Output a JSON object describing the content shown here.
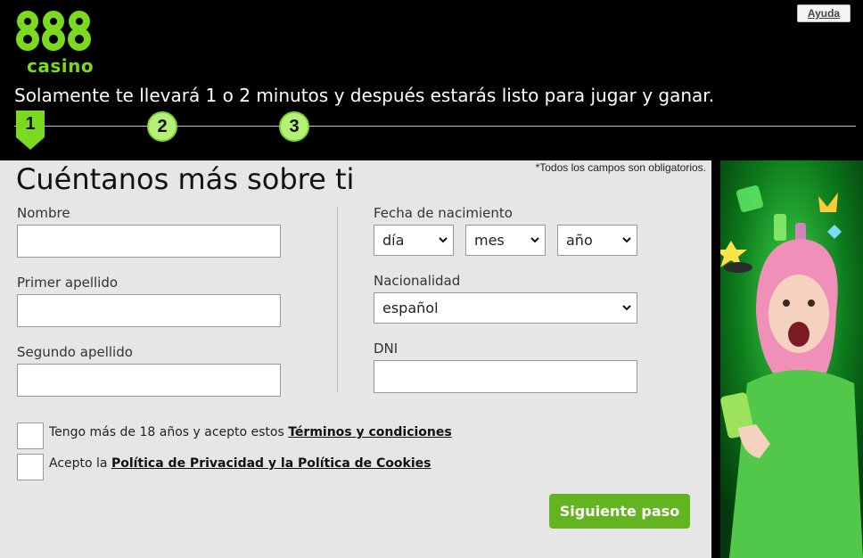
{
  "header": {
    "logo_text": "casino",
    "help_label": "Ayuda",
    "tagline": "Solamente te llevará 1 o 2 minutos y después estarás listo para jugar y ganar.",
    "steps": [
      "1",
      "2",
      "3"
    ]
  },
  "form": {
    "required_note": "*Todos los campos son obligatorios.",
    "title": "Cuéntanos más sobre ti",
    "fields": {
      "first_name": {
        "label": "Nombre",
        "value": ""
      },
      "last_name_1": {
        "label": "Primer apellido",
        "value": ""
      },
      "last_name_2": {
        "label": "Segundo apellido",
        "value": ""
      },
      "birth_date": {
        "label": "Fecha de nacimiento",
        "day": "día",
        "month": "mes",
        "year": "año"
      },
      "nationality": {
        "label": "Nacionalidad",
        "value": "español"
      },
      "dni": {
        "label": "DNI",
        "value": ""
      }
    },
    "checks": {
      "age_prefix": "Tengo más de 18 años y acepto estos ",
      "age_link": "Términos y condiciones",
      "privacy_prefix": "Acepto la ",
      "privacy_link": "Política de Privacidad y la Política de Cookies"
    },
    "submit_label": "Siguiente paso"
  },
  "colors": {
    "brand_green": "#7bd920",
    "button_green": "#64b320",
    "panel_bg": "#e6e6e6"
  }
}
